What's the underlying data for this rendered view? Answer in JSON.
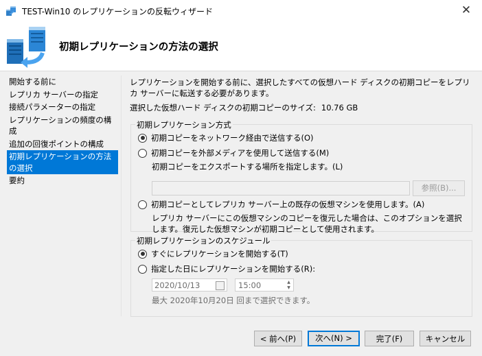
{
  "window": {
    "title": "TEST-Win10 のレプリケーションの反転ウィザード",
    "close_glyph": "✕"
  },
  "header": {
    "title": "初期レプリケーションの方法の選択"
  },
  "nav": {
    "items": [
      {
        "label": "開始する前に"
      },
      {
        "label": "レプリカ サーバーの指定"
      },
      {
        "label": "接続パラメーターの指定"
      },
      {
        "label": "レプリケーションの頻度の構成"
      },
      {
        "label": "追加の回復ポイントの構成"
      },
      {
        "label": "初期レプリケーションの方法の選択"
      },
      {
        "label": "要約"
      }
    ],
    "active_index": 5
  },
  "content": {
    "intro": "レプリケーションを開始する前に、選択したすべての仮想ハード ディスクの初期コピーをレプリカ サーバーに転送する必要があります。",
    "size_label": "選択した仮想ハード ディスクの初期コピーのサイズ:",
    "size_value": "10.76 GB",
    "method_group": {
      "label": "初期レプリケーション方式",
      "option_network": "初期コピーをネットワーク経由で送信する(O)",
      "option_external": "初期コピーを外部メディアを使用して送信する(M)",
      "export_location_label": "初期コピーをエクスポートする場所を指定します。(L)",
      "export_path_value": "",
      "browse_label": "参照(B)...",
      "option_existing_vm": "初期コピーとしてレプリカ サーバー上の既存の仮想マシンを使用します。(A)",
      "existing_vm_note": "レプリカ サーバーにこの仮想マシンのコピーを復元した場合は、このオプションを選択します。復元した仮想マシンが初期コピーとして使用されます。",
      "selected": "network"
    },
    "schedule_group": {
      "label": "初期レプリケーションのスケジュール",
      "option_now": "すぐにレプリケーションを開始する(T)",
      "option_later": "指定した日にレプリケーションを開始する(R):",
      "date_value": "2020/10/13",
      "time_value": "15:00",
      "note": "最大 2020年10月20日 回まで選択できます。",
      "selected": "now"
    }
  },
  "buttons": {
    "previous": "< 前へ(P)",
    "next": "次へ(N) >",
    "finish": "完了(F)",
    "cancel": "キャンセル"
  },
  "colors": {
    "selection": "#0078d7",
    "background": "#f0f0f0",
    "disabled_text": "#6d6d6d"
  },
  "icons": {
    "title": "server-replication-icon",
    "header": "server-replication-wizard-icon"
  }
}
